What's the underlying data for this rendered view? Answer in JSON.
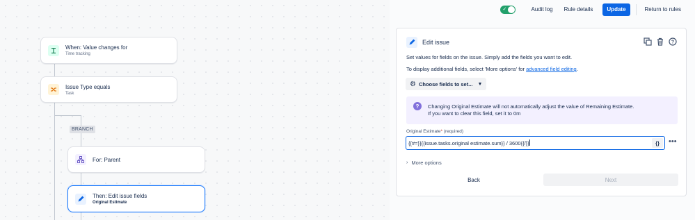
{
  "toolbar": {
    "toggle_state": "on",
    "audit_log": "Audit log",
    "rule_details": "Rule details",
    "update": "Update",
    "return_to_rules": "Return to rules"
  },
  "flow": {
    "trigger": {
      "title": "When: Value changes for",
      "subtitle": "Time tracking",
      "icon": "stopwatch-icon"
    },
    "condition": {
      "title": "Issue Type equals",
      "subtitle": "Task",
      "icon": "shuffle-icon"
    },
    "branch_tag": "BRANCH",
    "branch_node": {
      "title": "For: Parent",
      "icon": "hierarchy-icon"
    },
    "action_node": {
      "title": "Then: Edit issue fields",
      "subtitle": "Original Estimate",
      "icon": "pencil-icon"
    }
  },
  "panel": {
    "title": "Edit issue",
    "desc1": "Set values for fields on the issue. Simply add the fields you want to edit.",
    "desc2_prefix": "To display additional fields, select 'More options' for ",
    "desc2_link": "advanced field editing",
    "desc2_suffix": ".",
    "choose_fields": "Choose fields to set...",
    "info_line1": "Changing Original Estimate will not automatically adjust the value of Remaining Estimate.",
    "info_line2": "If you want to clear this field, set it to 0m",
    "field_label": "Original Estimate",
    "field_required_mark": "*",
    "field_required_text": "(required)",
    "field_value": "{{#=}}{{issue.tasks.original estimate.sum}} / 3600{{/}}",
    "braces_button": "{}",
    "more_options": "More options",
    "back": "Back",
    "next": "Next"
  },
  "colors": {
    "primary": "#0c66e4",
    "toggle_on": "#22a06b",
    "selected_border": "#1d7afc",
    "info_bg": "#f3f0ff"
  }
}
